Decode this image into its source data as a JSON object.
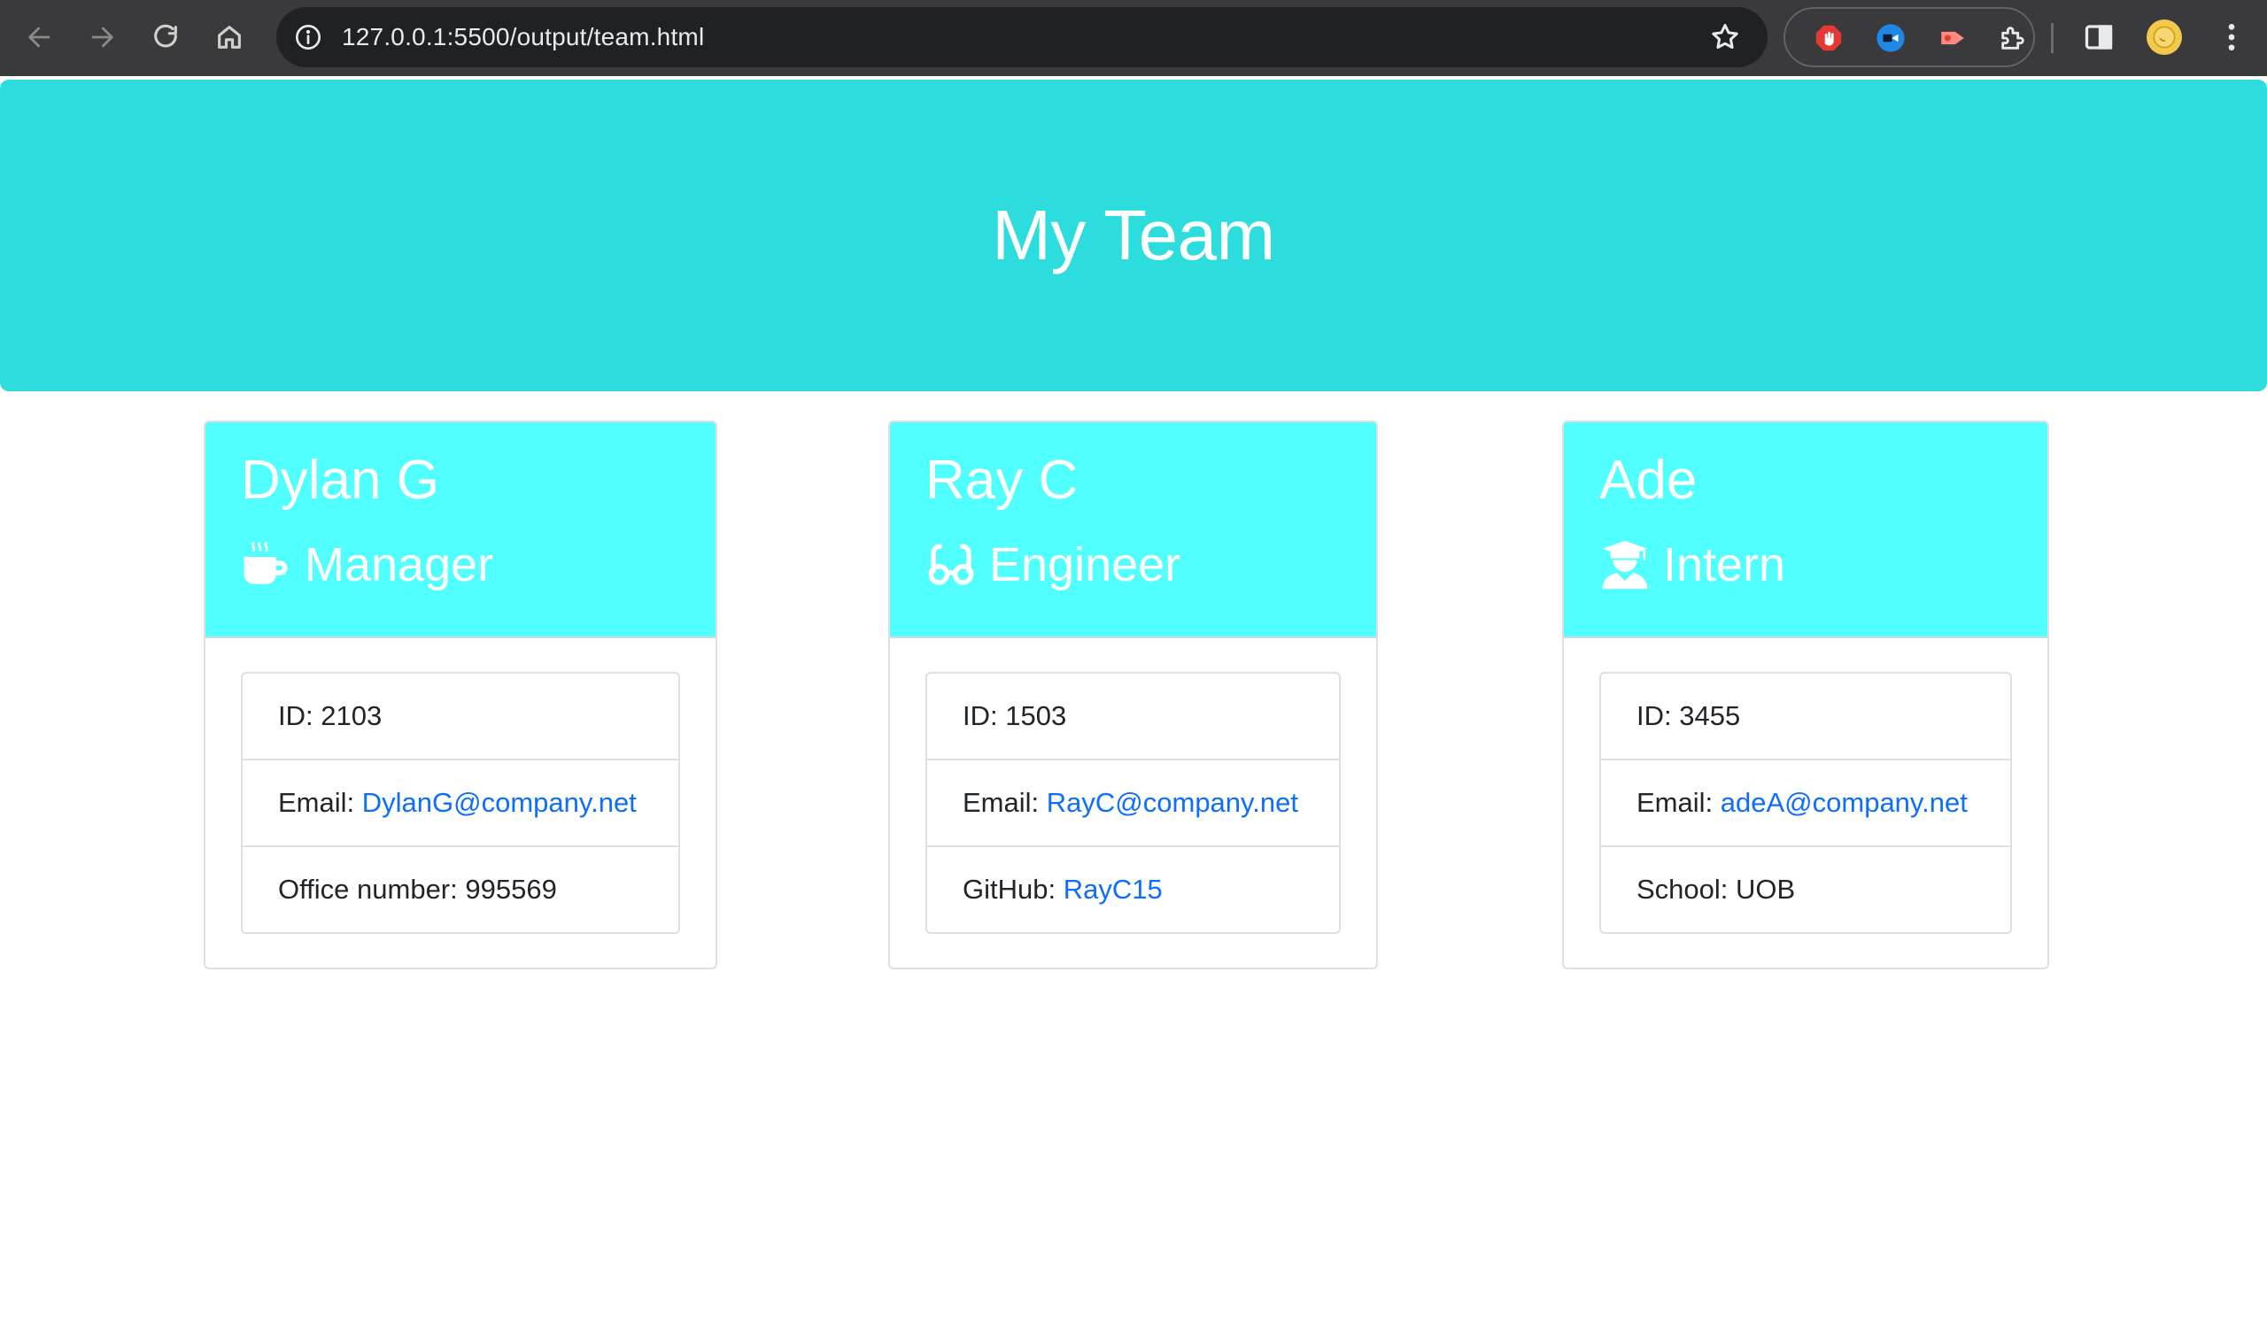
{
  "browser": {
    "url": "127.0.0.1:5500/output/team.html",
    "icons": {
      "back": "arrow-left-icon",
      "forward": "arrow-right-icon",
      "reload": "reload-icon",
      "home": "home-icon",
      "site_info": "info-icon",
      "bookmark": "star-icon",
      "extensions": [
        "adblock-icon",
        "video-icon",
        "cast-icon",
        "puzzle-icon"
      ],
      "side_panel": "side-panel-icon",
      "menu": "kebab-menu-icon"
    }
  },
  "header": {
    "title": "My Team",
    "background_color": "#2ddddd"
  },
  "colors": {
    "card_header": "#52ffff",
    "link": "#0d6efd"
  },
  "team": [
    {
      "name": "Dylan G",
      "role": "Manager",
      "role_icon": "coffee-mug-icon",
      "id_label": "ID:",
      "id": "2103",
      "email_label": "Email:",
      "email": "DylanG@company.net",
      "extra_label": "Office number:",
      "extra_value": "995569"
    },
    {
      "name": "Ray C",
      "role": "Engineer",
      "role_icon": "glasses-icon",
      "id_label": "ID:",
      "id": "1503",
      "email_label": "Email:",
      "email": "RayC@company.net",
      "extra_label": "GitHub:",
      "extra_value": "RayC15"
    },
    {
      "name": "Ade",
      "role": "Intern",
      "role_icon": "graduate-icon",
      "id_label": "ID:",
      "id": "3455",
      "email_label": "Email:",
      "email": "adeA@company.net",
      "extra_label": "School:",
      "extra_value": "UOB"
    }
  ]
}
